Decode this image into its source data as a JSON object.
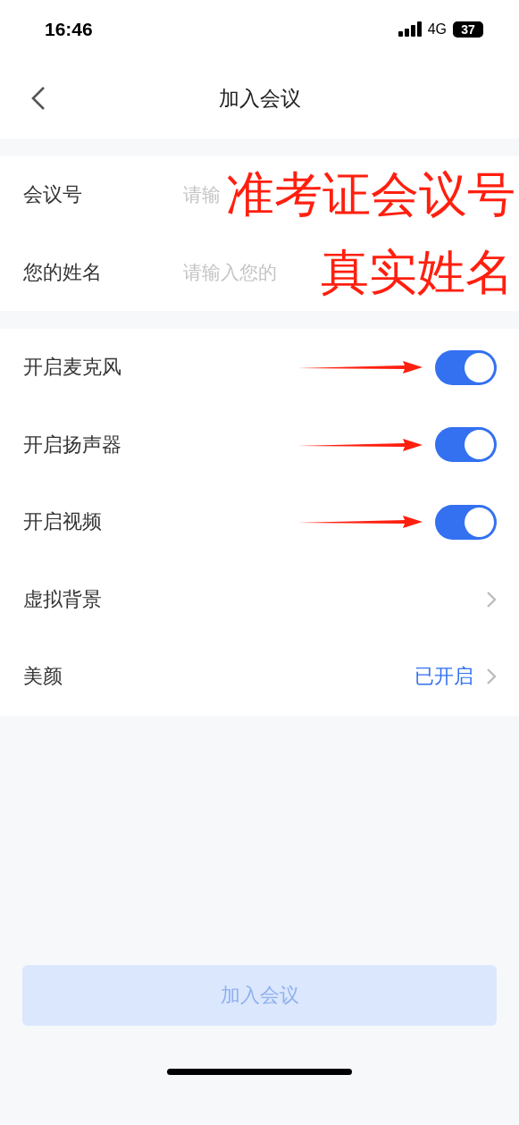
{
  "status_bar": {
    "time": "16:46",
    "network": "4G",
    "battery": "37"
  },
  "nav": {
    "title": "加入会议"
  },
  "fields": [
    {
      "label": "会议号",
      "placeholder": "请输",
      "note": "准考证会议号"
    },
    {
      "label": "您的姓名",
      "placeholder": "请输入您的",
      "note": "真实姓名"
    }
  ],
  "settings": [
    {
      "kind": "toggle",
      "label": "开启麦克风",
      "on": true,
      "arrow": true
    },
    {
      "kind": "toggle",
      "label": "开启扬声器",
      "on": true,
      "arrow": true
    },
    {
      "kind": "toggle",
      "label": "开启视频",
      "on": true,
      "arrow": true
    },
    {
      "kind": "link",
      "label": "虚拟背景"
    },
    {
      "kind": "link",
      "label": "美颜",
      "value": "已开启"
    }
  ],
  "join_button": {
    "label": "加入会议",
    "disabled": true
  }
}
